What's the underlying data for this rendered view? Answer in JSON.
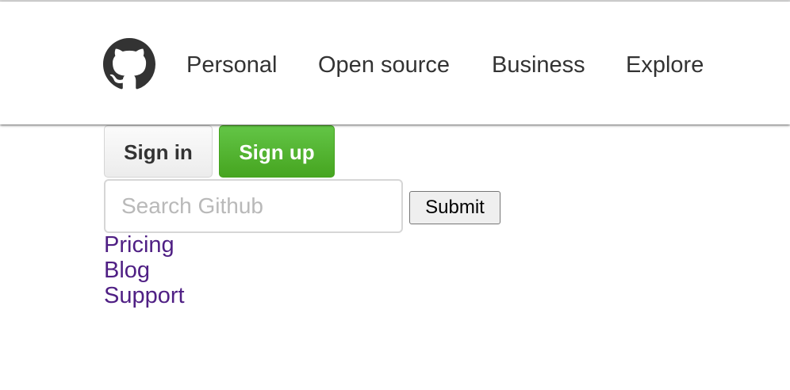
{
  "header": {
    "logo_icon": "github-octocat-icon",
    "nav": [
      {
        "label": "Personal"
      },
      {
        "label": "Open source"
      },
      {
        "label": "Business"
      },
      {
        "label": "Explore"
      }
    ]
  },
  "auth": {
    "signin_label": "Sign in",
    "signup_label": "Sign up"
  },
  "search": {
    "placeholder": "Search Github",
    "value": "",
    "submit_label": "Submit"
  },
  "links": [
    {
      "label": "Pricing"
    },
    {
      "label": "Blog"
    },
    {
      "label": "Support"
    }
  ],
  "colors": {
    "signup_green": "#4fb12a",
    "link_purple": "#4f1f84",
    "text_dark": "#333333"
  }
}
